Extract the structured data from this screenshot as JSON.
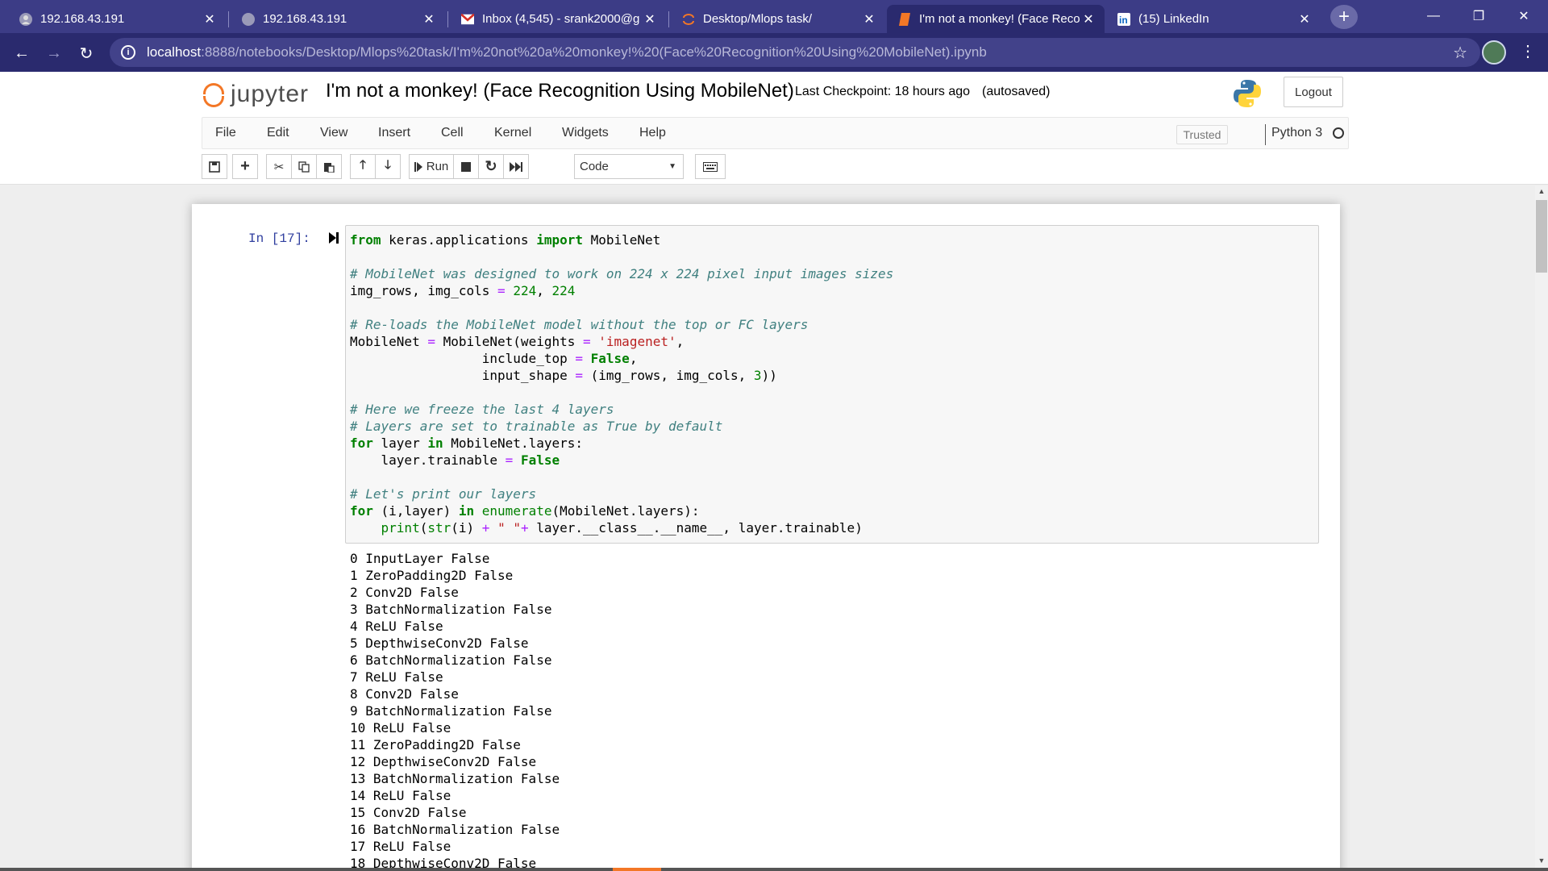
{
  "browser": {
    "tabs": [
      {
        "title": "192.168.43.191",
        "icon": "user-icon"
      },
      {
        "title": "192.168.43.191",
        "icon": "globe-icon"
      },
      {
        "title": "Inbox (4,545) - srank2000@g",
        "icon": "gmail-icon"
      },
      {
        "title": "Desktop/Mlops task/",
        "icon": "jupyter-icon"
      },
      {
        "title": "I'm not a monkey! (Face Reco",
        "icon": "notebook-icon"
      },
      {
        "title": "(15) LinkedIn",
        "icon": "linkedin-icon"
      }
    ],
    "active_tab": 4,
    "url_host": "localhost",
    "url_path": ":8888/notebooks/Desktop/Mlops%20task/I'm%20not%20a%20monkey!%20(Face%20Recognition%20Using%20MobileNet).ipynb"
  },
  "header": {
    "logo_text": "jupyter",
    "notebook_title": "I'm not a monkey! (Face Recognition Using MobileNet)",
    "checkpoint": "Last Checkpoint: 18 hours ago",
    "autosaved": "(autosaved)",
    "logout_label": "Logout"
  },
  "menubar": {
    "items": [
      "File",
      "Edit",
      "View",
      "Insert",
      "Cell",
      "Kernel",
      "Widgets",
      "Help"
    ],
    "trusted_label": "Trusted",
    "kernel_name": "Python 3"
  },
  "toolbar": {
    "run_label": "Run",
    "cell_type": "Code"
  },
  "cell": {
    "prompt": "In [17]:",
    "output_lines": [
      "0 InputLayer False",
      "1 ZeroPadding2D False",
      "2 Conv2D False",
      "3 BatchNormalization False",
      "4 ReLU False",
      "5 DepthwiseConv2D False",
      "6 BatchNormalization False",
      "7 ReLU False",
      "8 Conv2D False",
      "9 BatchNormalization False",
      "10 ReLU False",
      "11 ZeroPadding2D False",
      "12 DepthwiseConv2D False",
      "13 BatchNormalization False",
      "14 ReLU False",
      "15 Conv2D False",
      "16 BatchNormalization False",
      "17 ReLU False",
      "18 DepthwiseConv2D False"
    ]
  },
  "colors": {
    "tabbar": "#3c3c86",
    "jupyter_orange": "#f37726",
    "prompt_blue": "#303f9f"
  }
}
